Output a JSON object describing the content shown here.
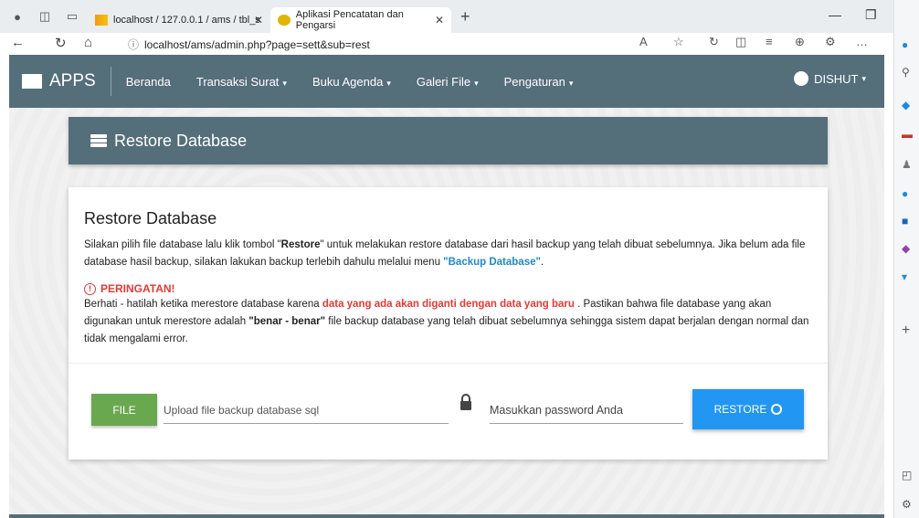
{
  "browser": {
    "tab1_title": "localhost / 127.0.0.1 / ams / tbl_s",
    "tab2_title": "Aplikasi Pencatatan dan Pengarsi",
    "url": "localhost/ams/admin.php?page=sett&sub=rest"
  },
  "navbar": {
    "brand": "APPS",
    "items": [
      {
        "label": "Beranda",
        "caret": ""
      },
      {
        "label": "Transaksi Surat",
        "caret": "▾"
      },
      {
        "label": "Buku Agenda",
        "caret": "▾"
      },
      {
        "label": "Galeri File",
        "caret": "▾"
      },
      {
        "label": "Pengaturan",
        "caret": "▾"
      }
    ],
    "user": "DISHUT",
    "user_caret": "▾"
  },
  "header": {
    "title": "Restore Database"
  },
  "card": {
    "title": "Restore Database",
    "desc_1": "Silakan pilih file database lalu klik tombol \"",
    "desc_bold": "Restore",
    "desc_2": "\" untuk melakukan restore database dari hasil backup yang telah dibuat sebelumnya. Jika belum ada file database hasil backup, silakan lakukan backup terlebih dahulu melalui menu ",
    "desc_link": "\"Backup Database\"",
    "desc_3": ".",
    "warning_title": "PERINGATAN!",
    "warn_1": "Berhati - hatilah ketika merestore database karena ",
    "warn_red": "data yang ada akan diganti dengan data yang baru",
    "warn_2": " . Pastikan bahwa file database yang akan digunakan untuk merestore adalah ",
    "warn_bold": "\"benar - benar\"",
    "warn_3": " file backup database yang telah dibuat sebelumnya sehingga sistem dapat berjalan dengan normal dan tidak mengalami error."
  },
  "form": {
    "file_button": "FILE",
    "file_placeholder": "Upload file backup database sql",
    "password_placeholder": "Masukkan password Anda",
    "restore_button": "RESTORE"
  },
  "colors": {
    "navbar": "#546e7a",
    "file_button": "#6aa84f",
    "restore_button": "#2196f3",
    "warning": "#e53935",
    "link": "#1e88c8"
  }
}
